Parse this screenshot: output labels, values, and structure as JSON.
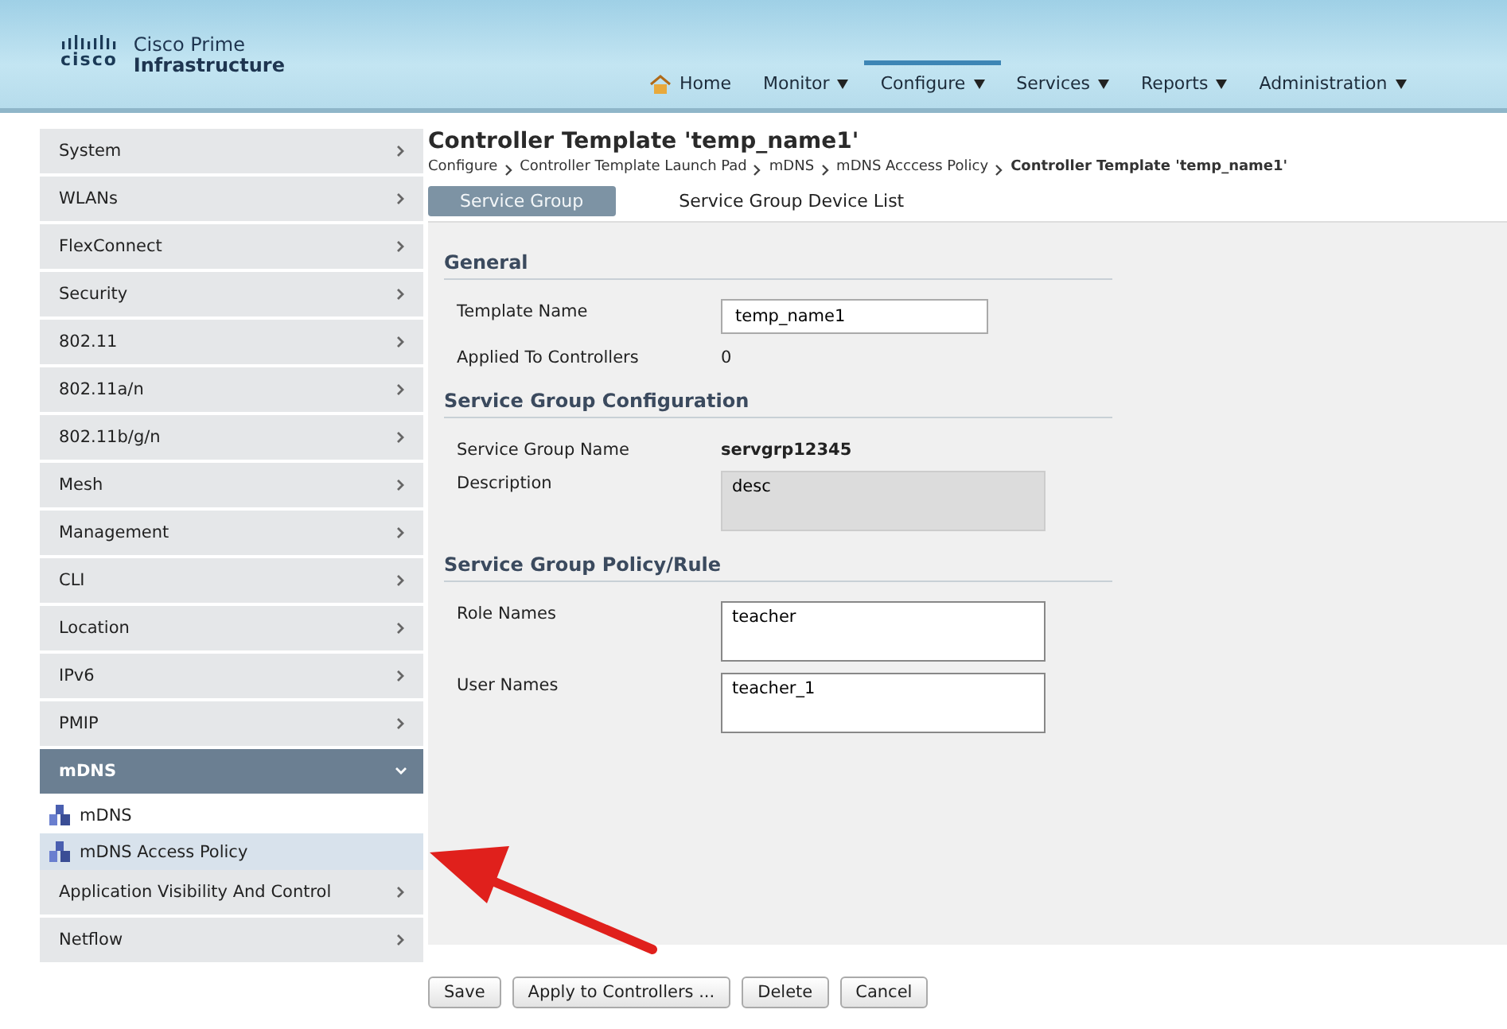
{
  "brand": {
    "logo": "cisco",
    "product_line1": "Cisco Prime",
    "product_line2": "Infrastructure"
  },
  "nav": [
    {
      "label": "Home",
      "kind": "home",
      "selected": false
    },
    {
      "label": "Monitor",
      "kind": "menu",
      "selected": false
    },
    {
      "label": "Configure",
      "kind": "menu",
      "selected": true
    },
    {
      "label": "Services",
      "kind": "menu",
      "selected": false
    },
    {
      "label": "Reports",
      "kind": "menu",
      "selected": false
    },
    {
      "label": "Administration",
      "kind": "menu",
      "selected": false
    }
  ],
  "sidebar": {
    "items": [
      {
        "label": "System",
        "expanded": false
      },
      {
        "label": "WLANs",
        "expanded": false
      },
      {
        "label": "FlexConnect",
        "expanded": false
      },
      {
        "label": "Security",
        "expanded": false
      },
      {
        "label": "802.11",
        "expanded": false
      },
      {
        "label": "802.11a/n",
        "expanded": false
      },
      {
        "label": "802.11b/g/n",
        "expanded": false
      },
      {
        "label": "Mesh",
        "expanded": false
      },
      {
        "label": "Management",
        "expanded": false
      },
      {
        "label": "CLI",
        "expanded": false
      },
      {
        "label": "Location",
        "expanded": false
      },
      {
        "label": "IPv6",
        "expanded": false
      },
      {
        "label": "PMIP",
        "expanded": false
      },
      {
        "label": "mDNS",
        "expanded": true,
        "children": [
          {
            "label": "mDNS",
            "selected": false
          },
          {
            "label": "mDNS Access Policy",
            "selected": true
          }
        ]
      },
      {
        "label": "Application Visibility And Control",
        "expanded": false
      },
      {
        "label": "Netflow",
        "expanded": false
      }
    ]
  },
  "page": {
    "title": "Controller Template 'temp_name1'",
    "breadcrumb": [
      "Configure",
      "Controller Template Launch Pad",
      "mDNS",
      "mDNS Acccess Policy",
      "Controller Template 'temp_name1'"
    ],
    "tabs": [
      {
        "label": "Service Group",
        "selected": true
      },
      {
        "label": "Service Group Device List",
        "selected": false
      }
    ]
  },
  "sections": [
    {
      "title": "General",
      "fields": [
        {
          "label": "Template Name",
          "kind": "input",
          "value": "temp_name1"
        },
        {
          "label": "Applied To Controllers",
          "kind": "text",
          "value": "0"
        }
      ]
    },
    {
      "title": "Service Group Configuration",
      "fields": [
        {
          "label": "Service Group Name",
          "kind": "bold",
          "value": "servgrp12345"
        },
        {
          "label": "Description",
          "kind": "readonly",
          "value": "desc"
        }
      ]
    },
    {
      "title": "Service Group Policy/Rule",
      "fields": [
        {
          "label": "Role Names",
          "kind": "textarea",
          "value": "teacher"
        },
        {
          "label": "User Names",
          "kind": "textarea",
          "value": "teacher_1"
        }
      ]
    }
  ],
  "buttons": [
    "Save",
    "Apply to Controllers ...",
    "Delete",
    "Cancel"
  ]
}
